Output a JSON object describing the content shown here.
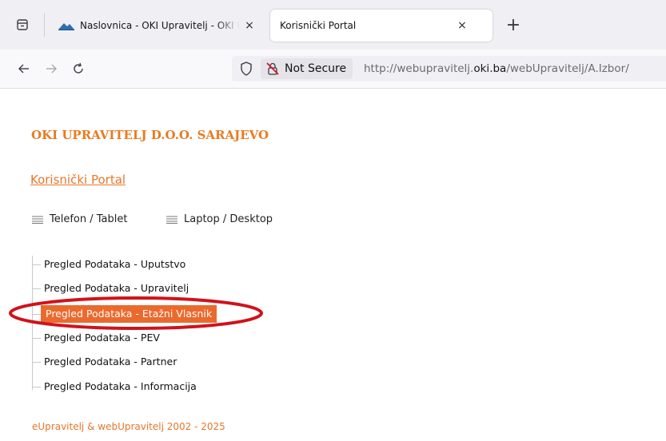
{
  "browser": {
    "tabs": [
      {
        "title": "Naslovnica - OKI Upravitelj - OKI Upravitelj",
        "active": false
      },
      {
        "title": "Korisnički Portal",
        "active": true
      }
    ],
    "close_glyph": "×",
    "new_tab_glyph": "+",
    "security_label": "Not Secure",
    "url": {
      "prefix": "http://webupravitelj.",
      "domain": "oki.ba",
      "suffix": "/webUpravitelj/A.Izbor/"
    }
  },
  "page": {
    "company_name": "OKI UPRAVITELJ D.O.O. SARAJEVO",
    "portal_link": "Korisnički Portal",
    "view_options": {
      "phone": "Telefon / Tablet",
      "laptop": "Laptop / Desktop"
    },
    "menu": [
      {
        "label": "Pregled Podataka - Uputstvo",
        "active": false
      },
      {
        "label": "Pregled Podataka - Upravitelj",
        "active": false
      },
      {
        "label": "Pregled Podataka - Etažni Vlasnik",
        "active": true
      },
      {
        "label": "Pregled Podataka - PEV",
        "active": false
      },
      {
        "label": "Pregled Podataka - Partner",
        "active": false
      },
      {
        "label": "Pregled Podataka - Informacija",
        "active": false
      }
    ],
    "footer": "eUpravitelj & webUpravitelj 2002 - 2025"
  },
  "colors": {
    "accent_orange": "#ea7a1f",
    "active_item_bg": "#ea6a2e",
    "annotation_red": "#d0121b"
  },
  "icons": [
    "tab-list-icon",
    "favicon-icon",
    "close-icon",
    "plus-icon",
    "back-arrow-icon",
    "forward-arrow-icon",
    "reload-icon",
    "shield-icon",
    "insecure-lock-icon",
    "menu-lines-icon"
  ]
}
